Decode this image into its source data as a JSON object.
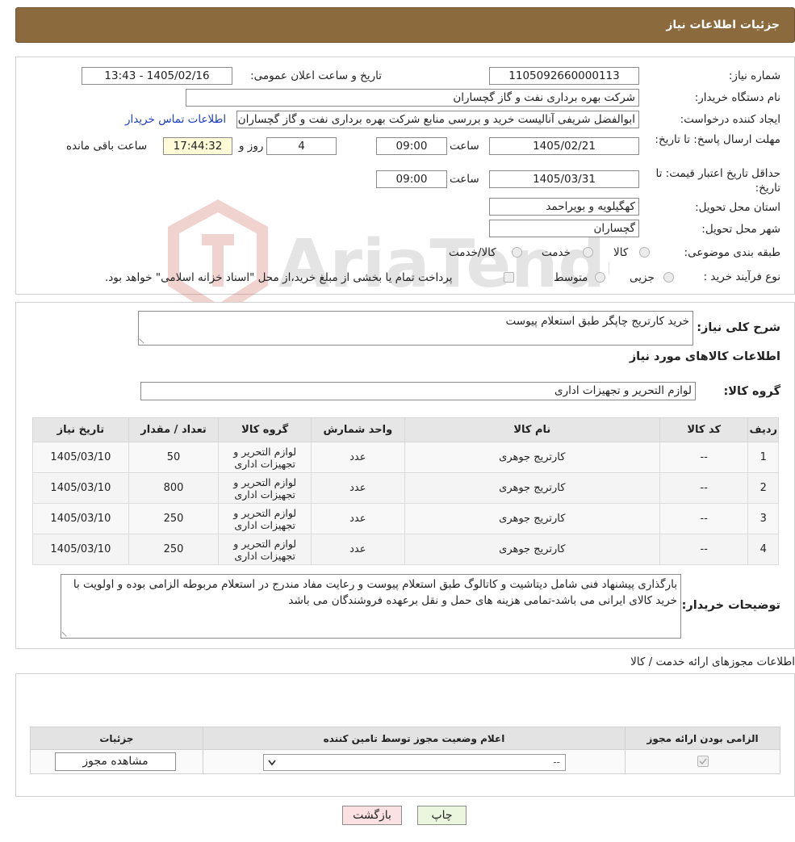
{
  "header": {
    "title": "جزئیات اطلاعات نیاز"
  },
  "fields": {
    "need_number_label": "شماره نیاز:",
    "need_number": "1105092660000113",
    "announce_label": "تاریخ و ساعت اعلان عمومی:",
    "announce_value": "1405/02/16 - 13:43",
    "buyer_org_label": "نام دستگاه خریدار:",
    "buyer_org": "شرکت بهره برداری نفت و گاز گچساران",
    "requester_label": "ایجاد کننده درخواست:",
    "requester": "ابوالفضل شریفی آنالیست خرید و بررسی منابع شرکت بهره برداری نفت و گاز گچساران",
    "contact_link": "اطلاعات تماس خریدار",
    "deadline_label": "مهلت ارسال پاسخ: تا تاریخ:",
    "deadline_date": "1405/02/21",
    "time_label": "ساعت",
    "deadline_time": "09:00",
    "days_value": "4",
    "days_label": "روز و",
    "remaining_time": "17:44:32",
    "remaining_label": "ساعت باقی مانده",
    "validity_label": "حداقل تاریخ اعتبار قیمت: تا تاریخ:",
    "validity_date": "1405/03/31",
    "validity_time": "09:00",
    "province_label": "استان محل تحویل:",
    "province": "کهگیلویه و بویراحمد",
    "city_label": "شهر محل تحویل:",
    "city": "گچساران",
    "category_label": "طبقه بندی موضوعی:",
    "category_options": [
      "کالا",
      "خدمت",
      "کالا/خدمت"
    ],
    "process_label": "نوع فرآیند خرید :",
    "process_options": [
      "جزیی",
      "متوسط"
    ],
    "process_note": "پرداخت تمام یا بخشی از مبلغ خرید،از محل \"اسناد خزانه اسلامی\" خواهد بود."
  },
  "description": {
    "label": "شرح کلی نیاز:",
    "value": "خرید کارتریج چاپگر طبق استعلام پیوست"
  },
  "goods_section_title": "اطلاعات کالاهای مورد نیاز",
  "goods_group": {
    "label": "گروه کالا:",
    "value": "لوازم التحریر و تجهیزات اداری"
  },
  "items_table": {
    "headers": [
      "ردیف",
      "کد کالا",
      "نام کالا",
      "واحد شمارش",
      "گروه کالا",
      "تعداد / مقدار",
      "تاریخ نیاز"
    ],
    "rows": [
      [
        "1",
        "--",
        "کارتریج جوهری",
        "عدد",
        "لوازم التحریر و تجهیزات اداری",
        "50",
        "1405/03/10"
      ],
      [
        "2",
        "--",
        "کارتریج جوهری",
        "عدد",
        "لوازم التحریر و تجهیزات اداری",
        "800",
        "1405/03/10"
      ],
      [
        "3",
        "--",
        "کارتریج جوهری",
        "عدد",
        "لوازم التحریر و تجهیزات اداری",
        "250",
        "1405/03/10"
      ],
      [
        "4",
        "--",
        "کارتریج جوهری",
        "عدد",
        "لوازم التحریر و تجهیزات اداری",
        "250",
        "1405/03/10"
      ]
    ]
  },
  "buyer_notes": {
    "label": "توضیحات خریدار:",
    "value": "بارگذاری پیشنهاد فنی شامل دیتاشیت و کاتالوگ طبق استعلام پیوست و رعایت مفاد مندرج در استعلام مربوطه الزامی بوده و اولویت با خرید کالای ایرانی می باشد-تمامی هزینه های حمل و نقل برعهده فروشندگان می باشد"
  },
  "licenses": {
    "title": "اطلاعات مجوزهای ارائه خدمت / کالا",
    "headers": [
      "الزامی بودن ارائه مجوز",
      "اعلام وضعیت مجوز توسط تامین کننده",
      "جزئیات"
    ],
    "select_value": "--",
    "view_button": "مشاهده مجوز"
  },
  "buttons": {
    "print": "چاپ",
    "back": "بازگشت"
  },
  "watermark_text": "AriaTender.neT"
}
